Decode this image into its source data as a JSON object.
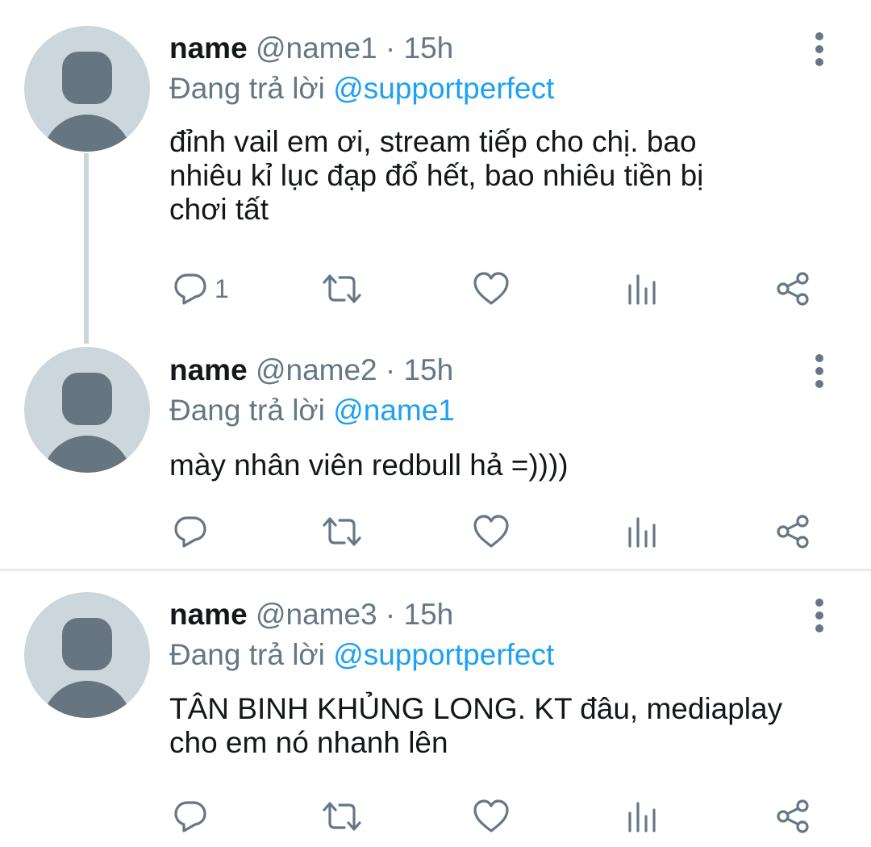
{
  "tweets": [
    {
      "name": "name",
      "handle": "@name1 · 15h",
      "reply_prefix": "Đang trả lời",
      "reply_to": "@supportperfect",
      "lines": [
        "đỉnh vail em ơi, stream tiếp cho chị. bao",
        "nhiêu kỉ lục đạp đổ hết, bao nhiêu tiền bị",
        "chơi tất"
      ],
      "reply_count": "1"
    },
    {
      "name": "name",
      "handle": "@name2 · 15h",
      "reply_prefix": "Đang trả lời",
      "reply_to": "@name1",
      "lines": [
        "mày nhân viên redbull hả =))))"
      ],
      "reply_count": ""
    },
    {
      "name": "name",
      "handle": "@name3 · 15h",
      "reply_prefix": "Đang trả lời",
      "reply_to": "@supportperfect",
      "lines": [
        "TÂN BINH KHỦNG LONG. KT đâu, mediaplay",
        "cho em nó nhanh lên"
      ],
      "reply_count": ""
    }
  ],
  "icons": {
    "reply": "reply-icon",
    "retweet": "retweet-icon",
    "like": "heart-icon",
    "analytics": "analytics-icon",
    "share": "share-icon",
    "more": "more-vertical-icon"
  },
  "colors": {
    "text": "#14171a",
    "secondary": "#657786",
    "link": "#1da1f2",
    "avatar_bg": "#ccd6dd",
    "avatar_fg": "#66757f",
    "divider": "#e6ecf0"
  }
}
